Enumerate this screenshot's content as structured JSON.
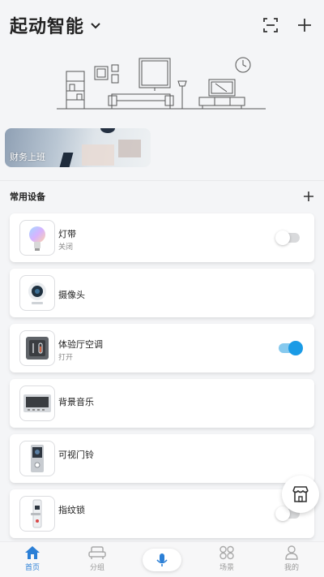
{
  "header": {
    "home_name": "起动智能",
    "icons": [
      "chevron-down-icon",
      "scan-icon",
      "plus-icon"
    ]
  },
  "scenes": [
    {
      "label": "财务上班"
    }
  ],
  "common_devices": {
    "title": "常用设备",
    "add_icon": "plus-icon",
    "items": [
      {
        "name": "灯带",
        "status": "关闭",
        "toggle": "off",
        "icon": "bulb-icon"
      },
      {
        "name": "摄像头",
        "status": "",
        "toggle": "none",
        "icon": "camera-icon"
      },
      {
        "name": "体验厅空调",
        "status": "打开",
        "toggle": "on",
        "icon": "thermostat-icon"
      },
      {
        "name": "背景音乐",
        "status": "",
        "toggle": "none",
        "icon": "music-panel-icon"
      },
      {
        "name": "可视门铃",
        "status": "",
        "toggle": "none",
        "icon": "doorbell-icon"
      },
      {
        "name": "指纹锁",
        "status": "",
        "toggle": "off",
        "icon": "fingerprint-lock-icon"
      }
    ]
  },
  "bottom_nav": {
    "items": [
      {
        "label": "首页",
        "icon": "home-icon",
        "active": true
      },
      {
        "label": "分组",
        "icon": "sofa-icon",
        "active": false
      },
      {
        "label": "场景",
        "icon": "scene-grid-icon",
        "active": false
      },
      {
        "label": "我的",
        "icon": "user-icon",
        "active": false
      }
    ],
    "mic_icon": "microphone-icon"
  },
  "colors": {
    "accent": "#1a9be6",
    "nav_active": "#2b7fd6",
    "background": "#f4f5f7"
  }
}
